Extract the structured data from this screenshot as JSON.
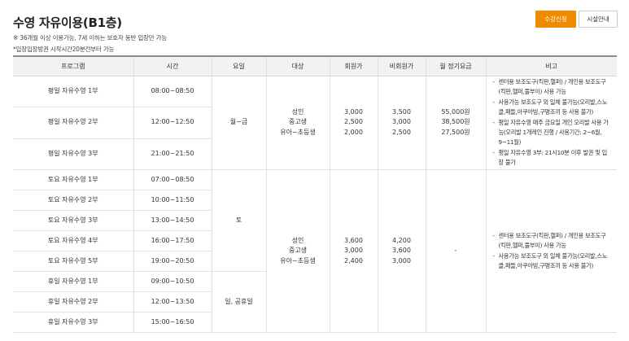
{
  "page": {
    "title": "수영 자유이용(B1층)",
    "apply_button": "수강신청",
    "facility_button": "시설안내",
    "notes": [
      "※ 36개월 이상 이용가능, 7세 이하는 보호자 동반 입장만 가능",
      "*입장입장방권 시작시간20분전부터 가능"
    ]
  },
  "table": {
    "headers": [
      "프로그램",
      "시간",
      "요일",
      "대상",
      "회원가",
      "비회원가",
      "월 정기요금",
      "비고"
    ],
    "weekday": {
      "rows": [
        {
          "program": "평일 자유수영 1부",
          "time": "08:00~08:50"
        },
        {
          "program": "평일 자유수영 2부",
          "time": "12:00~12:50"
        },
        {
          "program": "평일 자유수영 3부",
          "time": "21:00~21:50"
        }
      ],
      "days": "월~금",
      "targets": [
        "성인",
        "중고생",
        "유아~초등생"
      ],
      "member_prices": [
        "3,000",
        "2,500",
        "2,000"
      ],
      "nonmember_prices": [
        "3,500",
        "3,000",
        "2,500"
      ],
      "monthly_fees": [
        "55,000원",
        "38,500원",
        "27,500원"
      ],
      "remarks": [
        "센터용 보조도구(킥판,헬퍼) / 개인용 보조도구(킥판,헬퍼,풀부이) 사용 가능",
        "사용가능 보조도구 외 일체 불가능(오리발,스노클,패들,아쿠아빙,구명조끼 등 사용 불가)",
        "평일 자유수영 매주 금요일 개인 오리발 사용 가능(오리발 1개레인 진행 / 사용기간: 2~6월, 9~11월)",
        "평일 자유수영 3부: 21시10분 이후 발권 및 입장 불가"
      ]
    },
    "weekend": {
      "rows": [
        {
          "program": "토요 자유수영 1부",
          "time": "07:00~08:50"
        },
        {
          "program": "토요 자유수영 2부",
          "time": "10:00~11:50"
        },
        {
          "program": "토요 자유수영 3부",
          "time": "13:00~14:50"
        },
        {
          "program": "토요 자유수영 4부",
          "time": "16:00~17:50"
        },
        {
          "program": "토요 자유수영 5부",
          "time": "19:00~20:50"
        },
        {
          "program": "휴일 자유수영 1부",
          "time": "09:00~10:50"
        },
        {
          "program": "휴일 자유수영 2부",
          "time": "12:00~13:50"
        },
        {
          "program": "휴일 자유수영 3부",
          "time": "15:00~16:50"
        }
      ],
      "days_saturday": "토",
      "days_holiday": "일, 공휴일",
      "targets": [
        "성인",
        "중고생",
        "유아~초등생"
      ],
      "member_prices": [
        "3,600",
        "3,000",
        "2,400"
      ],
      "nonmember_prices": [
        "4,200",
        "3,600",
        "3,000"
      ],
      "monthly_fee": "-",
      "remarks": [
        "센터용 보조도구(킥판,헬퍼) / 개인용 보조도구(킥판,헬퍼,풀부이) 사용 가능",
        "사용가능 보조도구 외 일체 불가능(오리발,스노클,패들,아쿠아빙,구명조끼 등 사용 불가)"
      ]
    }
  }
}
